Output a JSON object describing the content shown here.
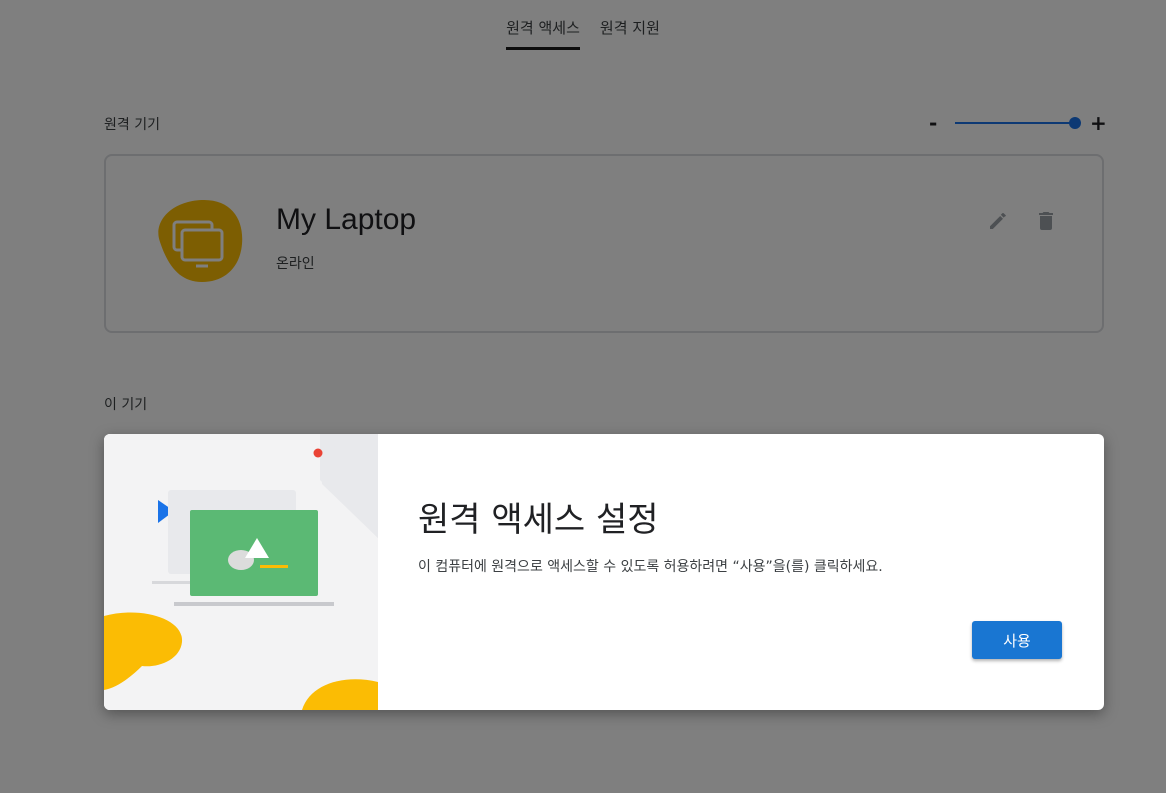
{
  "tabs": [
    {
      "label": "원격 액세스",
      "active": true
    },
    {
      "label": "원격 지원",
      "active": false
    }
  ],
  "remote_devices": {
    "label": "원격 기기",
    "size_slider": {
      "minus": "-",
      "plus": "+",
      "value": 1.0
    },
    "devices": [
      {
        "name": "My Laptop",
        "status": "온라인",
        "icon": "computer-icon"
      }
    ]
  },
  "this_device": {
    "label": "이 기기"
  },
  "dialog": {
    "title": "원격 액세스 설정",
    "text": "이 컴퓨터에 원격으로 액세스할 수 있도록 허용하려면 “사용”을(를) 클릭하세요.",
    "button_label": "사용"
  },
  "colors": {
    "accent": "#1a73e8",
    "button": "#1976d2",
    "device_icon_blob": "#fbbc04",
    "illustration_green": "#5bb974",
    "illustration_yellow": "#fbbc04"
  }
}
